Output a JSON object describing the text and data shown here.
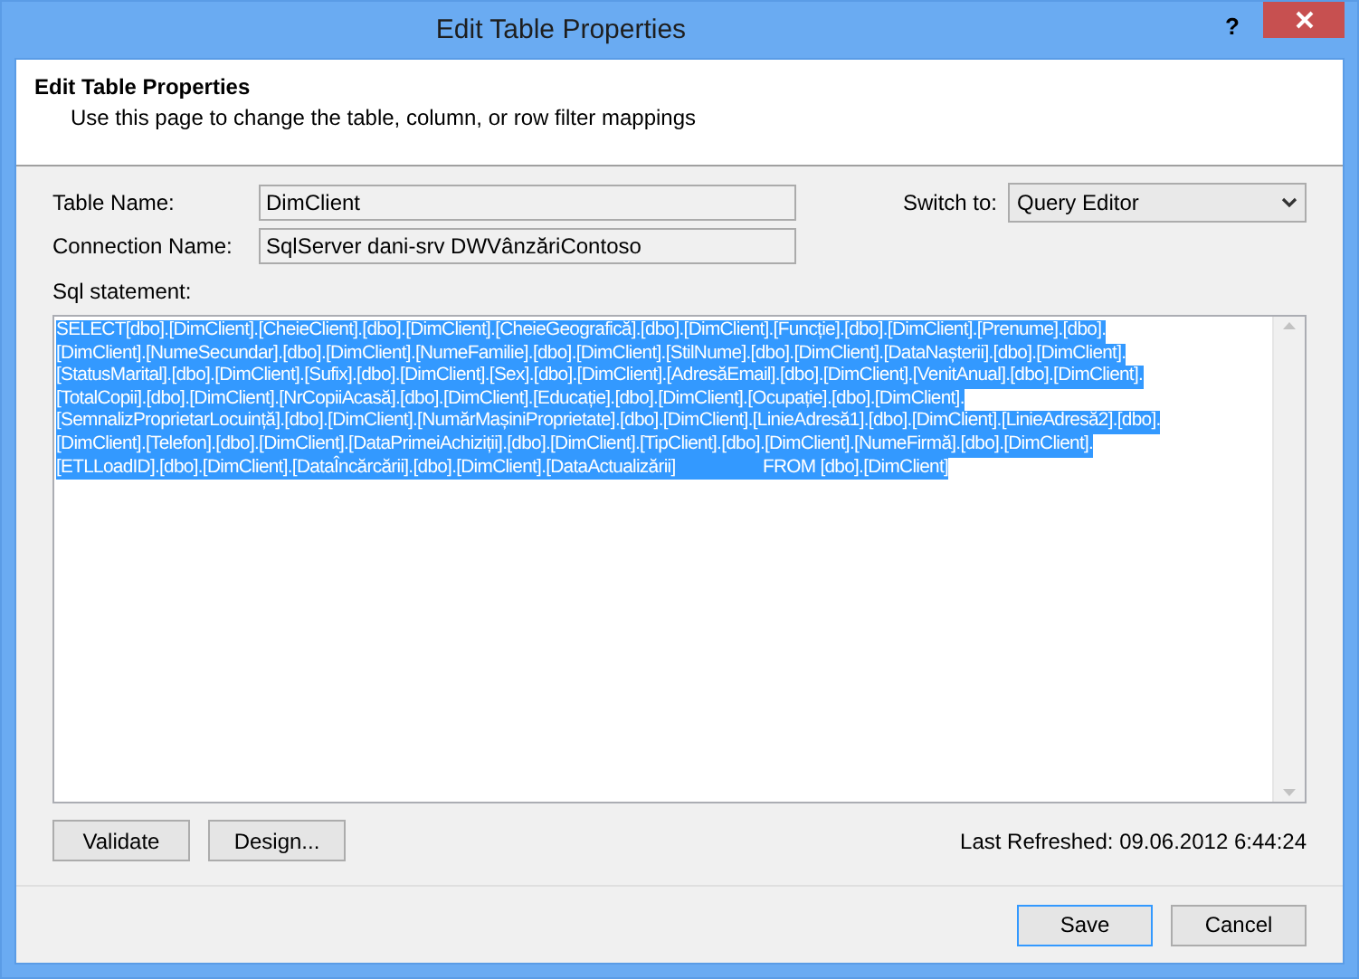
{
  "window": {
    "title": "Edit Table Properties",
    "help": "?"
  },
  "header": {
    "title": "Edit Table Properties",
    "subtitle": "Use this page to change the table, column, or row filter mappings"
  },
  "table_name": {
    "label": "Table Name:",
    "value": "DimClient"
  },
  "connection_name": {
    "label": "Connection Name:",
    "value": "SqlServer dani-srv DWVânzăriContoso"
  },
  "switch_to": {
    "label": "Switch to:",
    "value": "Query Editor"
  },
  "sql": {
    "label": "Sql statement:",
    "selected": true,
    "lines": [
      "SELECT[dbo].[DimClient].[CheieClient].[dbo].[DimClient].[CheieGeografică].[dbo].[DimClient].[Funcție].[dbo].[DimClient].[Prenume].[dbo].",
      "[DimClient].[NumeSecundar].[dbo].[DimClient].[NumeFamilie].[dbo].[DimClient].[StilNume].[dbo].[DimClient].[DataNașterii].[dbo].[DimClient].",
      "[StatusMarital].[dbo].[DimClient].[Sufix].[dbo].[DimClient].[Sex].[dbo].[DimClient].[AdresăEmail].[dbo].[DimClient].[VenitAnual].[dbo].[DimClient].",
      "[TotalCopii].[dbo].[DimClient].[NrCopiiAcasă].[dbo].[DimClient].[Educație].[dbo].[DimClient].[Ocupație].[dbo].[DimClient].",
      "[SemnalizProprietarLocuință].[dbo].[DimClient].[NumărMașiniProprietate].[dbo].[DimClient].[LinieAdresă1].[dbo].[DimClient].[LinieAdresă2].[dbo].",
      "[DimClient].[Telefon].[dbo].[DimClient].[DataPrimeiAchiziții].[dbo].[DimClient].[TipClient].[dbo].[DimClient].[NumeFirmă].[dbo].[DimClient].",
      "[ETLLoadID].[dbo].[DimClient].[DataÎncărcării].[dbo].[DimClient].[DataActualizării]                   FROM [dbo].[DimClient]"
    ]
  },
  "buttons_left": [
    "Validate",
    "Design..."
  ],
  "last_refreshed": "Last Refreshed: 09.06.2012 6:44:24",
  "buttons_right": [
    "Save",
    "Cancel"
  ]
}
